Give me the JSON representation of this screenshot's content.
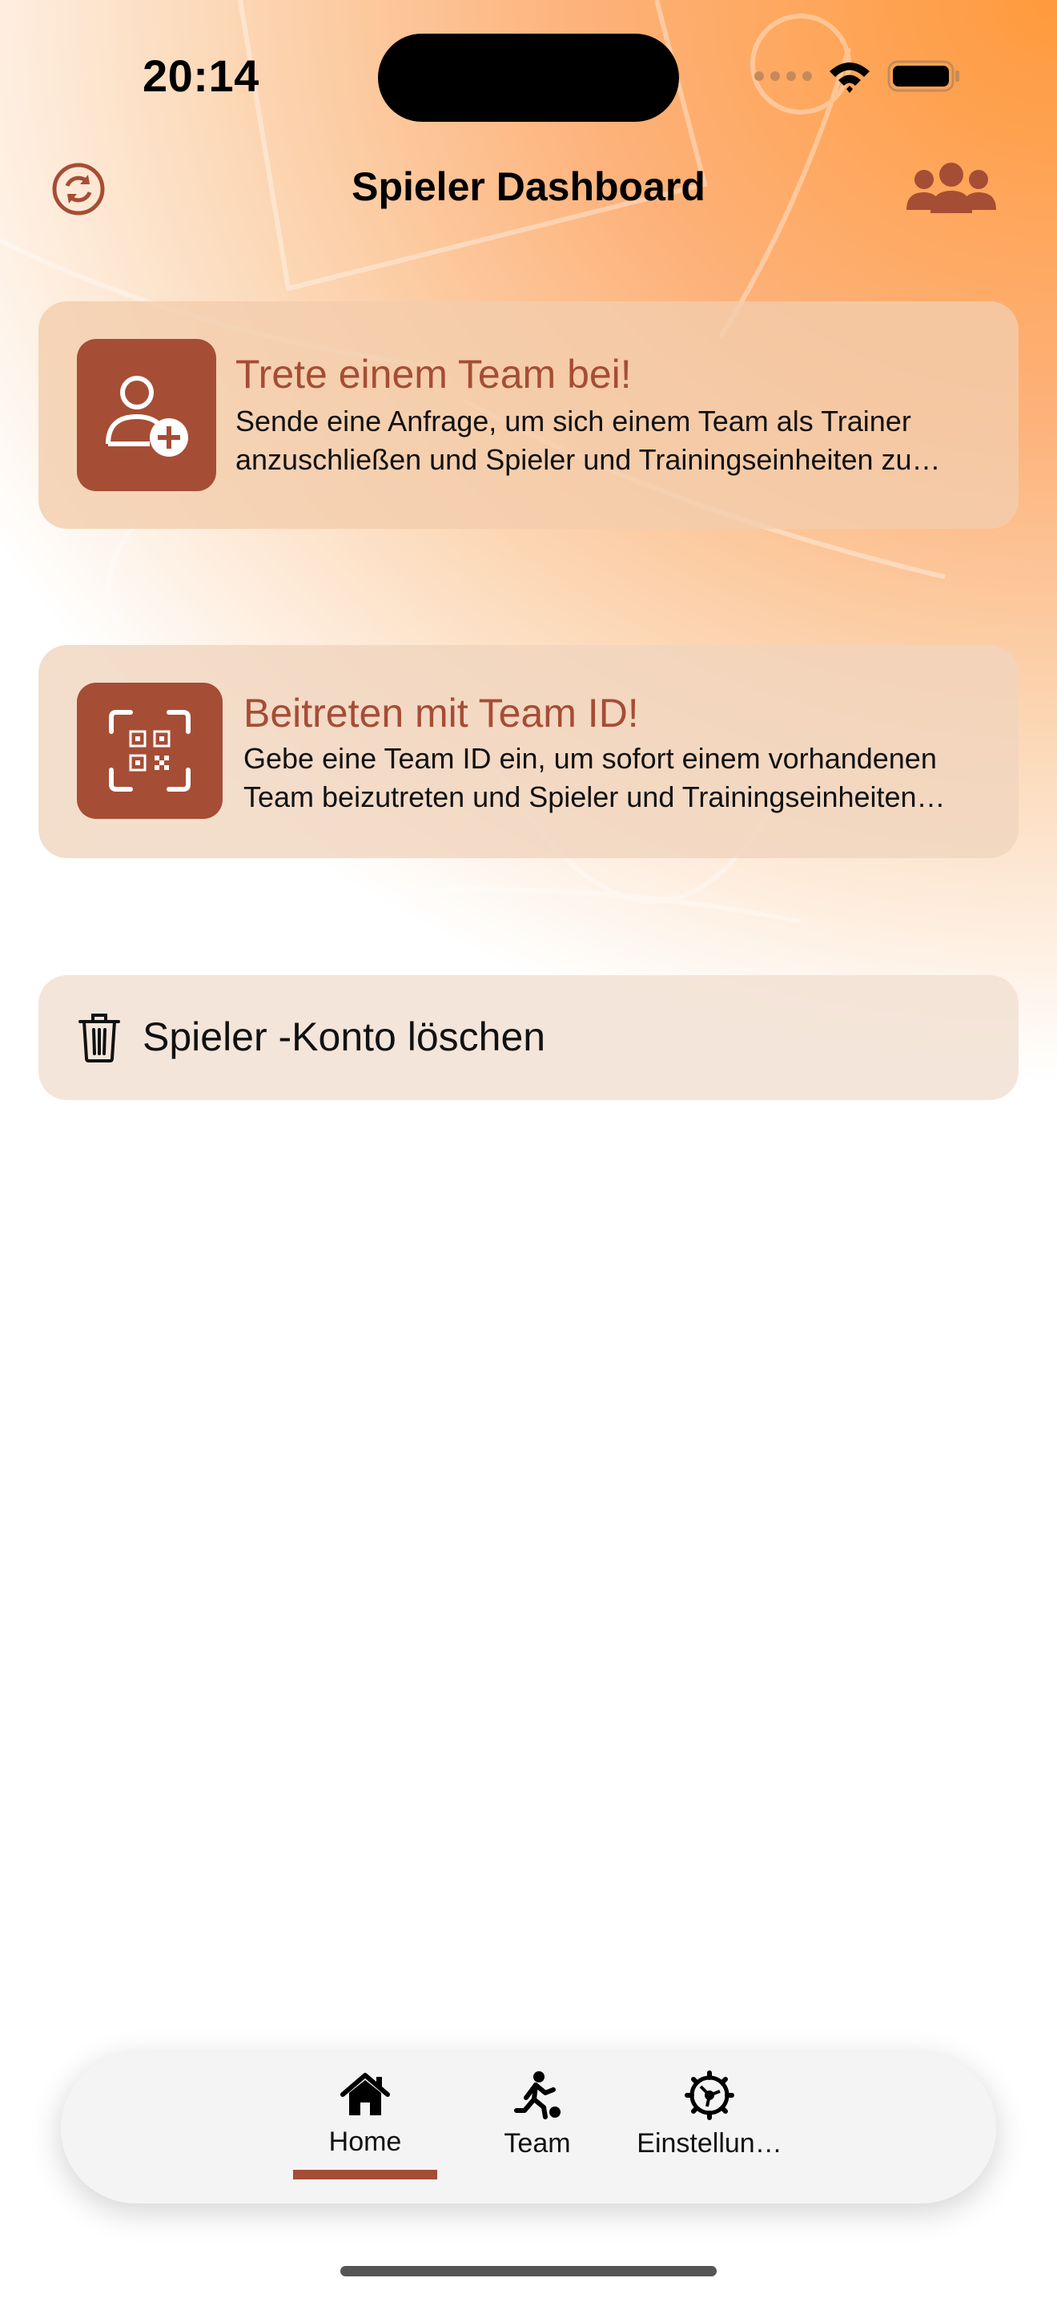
{
  "status_bar": {
    "time": "20:14"
  },
  "nav": {
    "title": "Spieler Dashboard",
    "left_icon": "refresh-icon",
    "right_icon": "people-group-icon"
  },
  "cards": [
    {
      "icon": "add-person-icon",
      "title": "Trete einem Team bei!",
      "line1": "Sende eine Anfrage, um sich einem Team als Trainer",
      "line2": "anzuschließen und Spieler und Trainingseinheiten zu…"
    },
    {
      "icon": "qr-scan-icon",
      "title": "Beitreten mit Team ID!",
      "line1": "Gebe eine Team ID ein, um sofort einem vorhandenen",
      "line2": "Team beizutreten und Spieler und Trainingseinheiten…"
    }
  ],
  "delete_account": {
    "icon": "trash-icon",
    "label": "Spieler -Konto löschen"
  },
  "tabbar": {
    "tabs": [
      {
        "label": "Home",
        "icon": "house-icon",
        "selected": true
      },
      {
        "label": "Team",
        "icon": "player-kick-icon",
        "selected": false
      },
      {
        "label": "Einstellun…",
        "icon": "gear-icon",
        "selected": false
      }
    ]
  },
  "colors": {
    "accent": "#a64d35",
    "gradient_orange": "#ff9a3c"
  }
}
